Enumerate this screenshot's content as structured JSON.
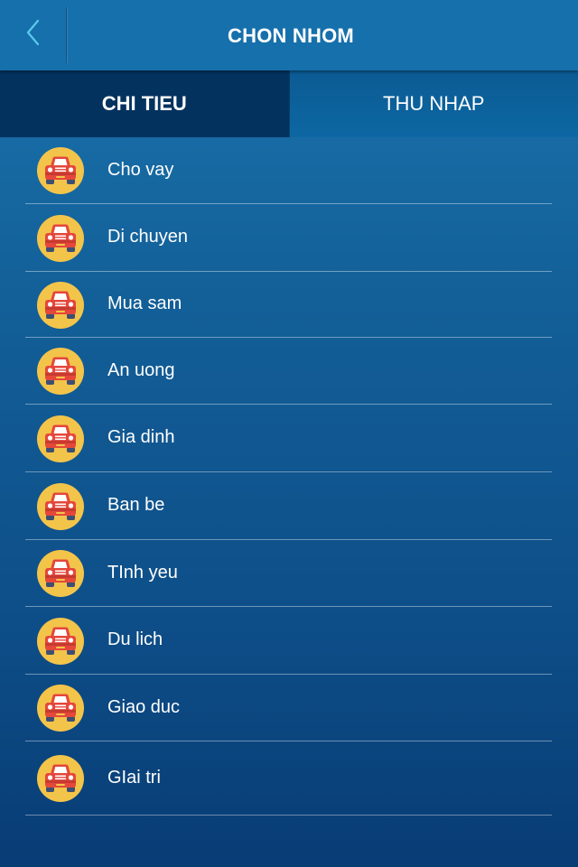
{
  "header": {
    "title": "CHON NHOM",
    "back_icon": "chevron-left-icon"
  },
  "tabs": [
    {
      "label": "CHI TIEU",
      "active": true
    },
    {
      "label": "THU NHAP",
      "active": false
    }
  ],
  "categories": [
    {
      "label": "Cho vay",
      "icon": "car-icon"
    },
    {
      "label": "Di chuyen",
      "icon": "car-icon"
    },
    {
      "label": "Mua sam",
      "icon": "car-icon"
    },
    {
      "label": "An uong",
      "icon": "car-icon"
    },
    {
      "label": "Gia dinh",
      "icon": "car-icon"
    },
    {
      "label": "Ban be",
      "icon": "car-icon"
    },
    {
      "label": "TInh yeu",
      "icon": "car-icon"
    },
    {
      "label": "Du lich",
      "icon": "car-icon"
    },
    {
      "label": "Giao duc",
      "icon": "car-icon"
    },
    {
      "label": "GIai tri",
      "icon": "car-icon"
    }
  ],
  "colors": {
    "header_bg": "#1670ac",
    "tab_active_bg": "#04325f",
    "icon_circle": "#f3c44a",
    "car_body": "#e5473b",
    "back_chevron": "#5cc8ee"
  }
}
